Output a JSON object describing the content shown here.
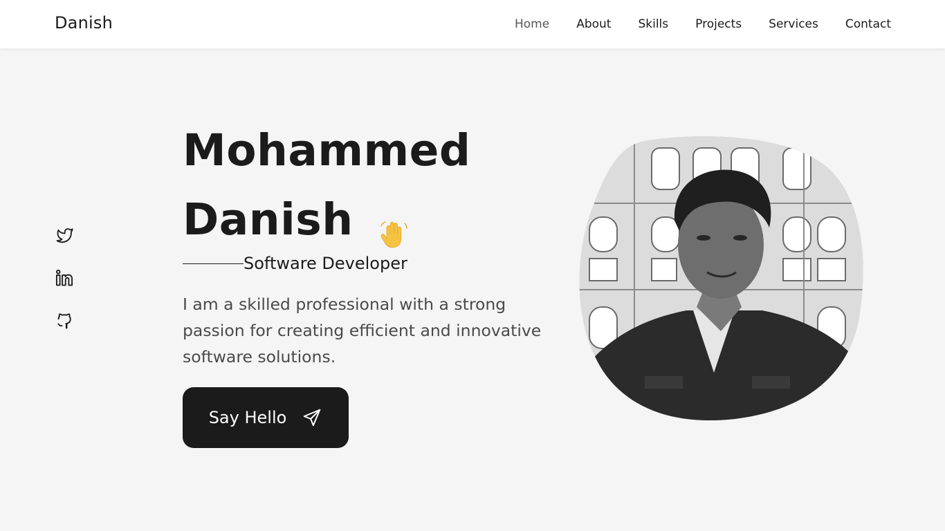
{
  "header": {
    "logo": "Danish",
    "nav": [
      {
        "label": "Home",
        "active": true
      },
      {
        "label": "About"
      },
      {
        "label": "Skills"
      },
      {
        "label": "Projects"
      },
      {
        "label": "Services"
      },
      {
        "label": "Contact"
      }
    ]
  },
  "social": [
    "twitter-icon",
    "linkedin-icon",
    "github-icon"
  ],
  "hero": {
    "name_line1": "Mohammed",
    "name_line2": "Danish",
    "wave_icon": "waving-hand-icon",
    "subtitle": "Software Developer",
    "description": "I am a skilled professional with a strong passion for creating efficient and innovative software solutions.",
    "cta_label": "Say Hello",
    "cta_icon": "send-icon"
  },
  "colors": {
    "background": "#f5f5f5",
    "header": "#ffffff",
    "text": "#1b1b1b",
    "button": "#1b1b1b",
    "button_text": "#ffffff",
    "wave": "#f5c242"
  }
}
